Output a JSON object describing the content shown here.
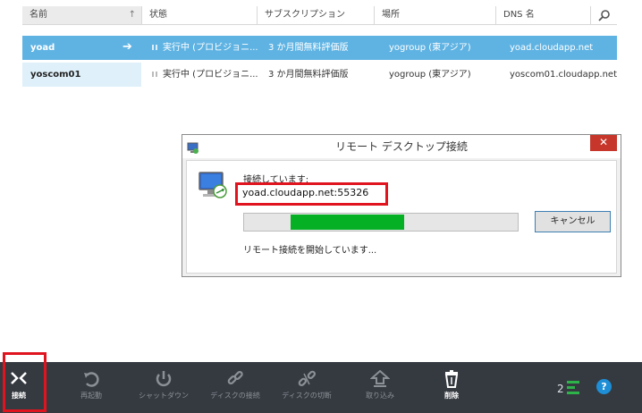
{
  "table": {
    "headers": [
      "名前",
      "状態",
      "サブスクリプション",
      "場所",
      "DNS 名"
    ],
    "rows": [
      {
        "name": "yoad",
        "status": "実行中 (プロビジョニ...",
        "subscription": "3 か月間無料評価版",
        "location": "yogroup (東アジア)",
        "dns": "yoad.cloudapp.net",
        "selected": true
      },
      {
        "name": "yoscom01",
        "status": "実行中 (プロビジョニ...",
        "subscription": "3 か月間無料評価版",
        "location": "yogroup (東アジア)",
        "dns": "yoscom01.cloudapp.net",
        "selected": false
      }
    ]
  },
  "dialog": {
    "title": "リモート デスクトップ接続",
    "connecting_label": "接続しています:",
    "host": "yoad.cloudapp.net:55326",
    "cancel_label": "キャンセル",
    "status_text": "リモート接続を開始しています...",
    "progress_fraction": 0.5
  },
  "toolbar": {
    "items": [
      {
        "label": "接続",
        "icon": "connect-icon",
        "active": true
      },
      {
        "label": "再起動",
        "icon": "restart-icon"
      },
      {
        "label": "シャットダウン",
        "icon": "power-icon"
      },
      {
        "label": "ディスクの接続",
        "icon": "attach-disk-icon"
      },
      {
        "label": "ディスクの切断",
        "icon": "detach-disk-icon"
      },
      {
        "label": "取り込み",
        "icon": "capture-icon"
      },
      {
        "label": "削除",
        "icon": "trash-icon",
        "active": true
      }
    ],
    "count": "2",
    "help_icon": "help-icon"
  },
  "colors": {
    "selected_row": "#5fb3e3",
    "progress": "#06b025",
    "highlight_box": "#e0141e",
    "toolbar_bg": "#353a41"
  }
}
